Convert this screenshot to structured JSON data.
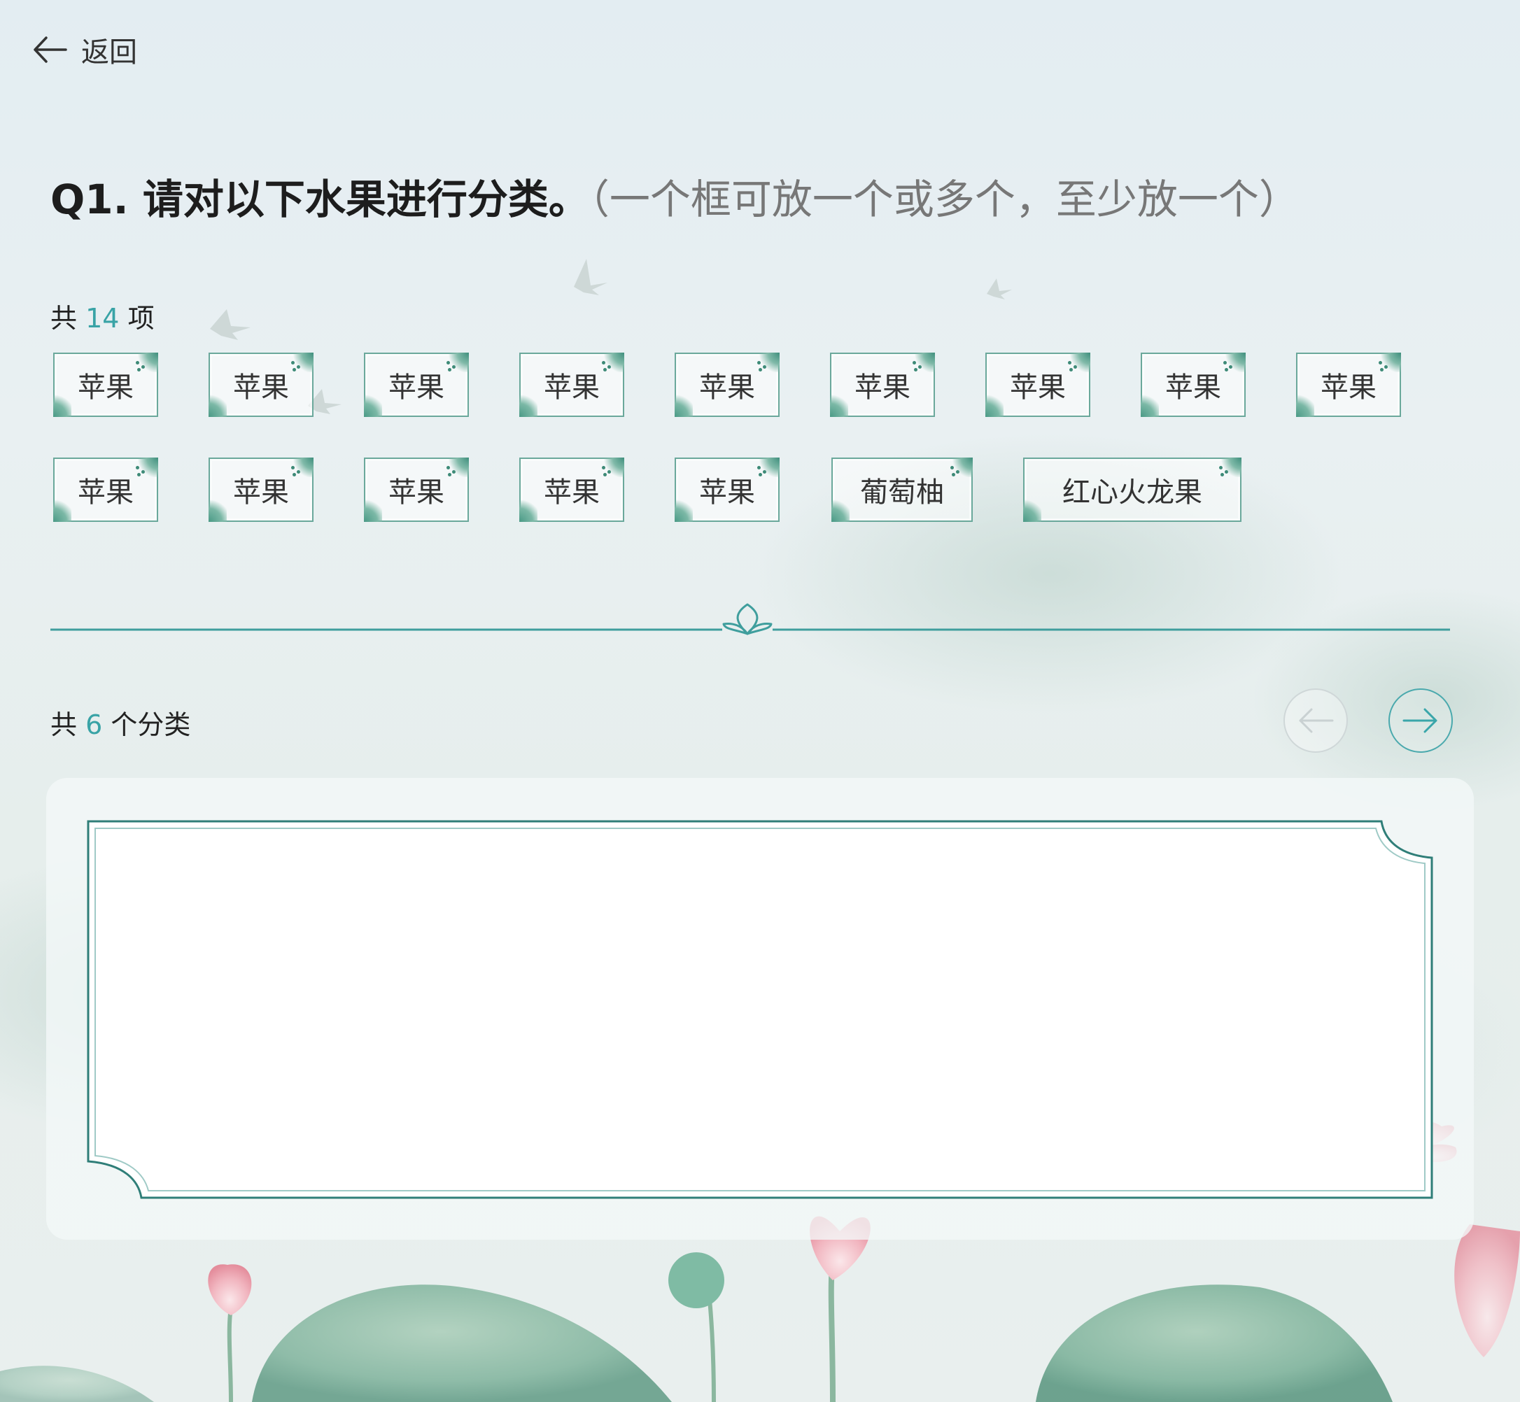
{
  "nav": {
    "back_label": "返回"
  },
  "question": {
    "title": "Q1. 请对以下水果进行分类。",
    "hint": "（一个框可放一个或多个，至少放一个）"
  },
  "items_summary": {
    "prefix": "共",
    "count": "14",
    "suffix": "项"
  },
  "items": [
    {
      "label": "苹果"
    },
    {
      "label": "苹果"
    },
    {
      "label": "苹果"
    },
    {
      "label": "苹果"
    },
    {
      "label": "苹果"
    },
    {
      "label": "苹果"
    },
    {
      "label": "苹果"
    },
    {
      "label": "苹果"
    },
    {
      "label": "苹果"
    },
    {
      "label": "苹果"
    },
    {
      "label": "苹果"
    },
    {
      "label": "苹果"
    },
    {
      "label": "苹果"
    },
    {
      "label": "苹果"
    },
    {
      "label": "葡萄柚"
    },
    {
      "label": "红心火龙果"
    }
  ],
  "categories_summary": {
    "prefix": "共",
    "count": "6",
    "suffix": "个分类"
  },
  "colors": {
    "accent": "#39a3a6",
    "frame": "#2f7e78",
    "tag_border": "#6aa89b"
  },
  "icons": {
    "back": "arrow-left-icon",
    "prev": "arrow-left-icon",
    "next": "arrow-right-icon",
    "divider_ornament": "lotus-ornament-icon"
  }
}
